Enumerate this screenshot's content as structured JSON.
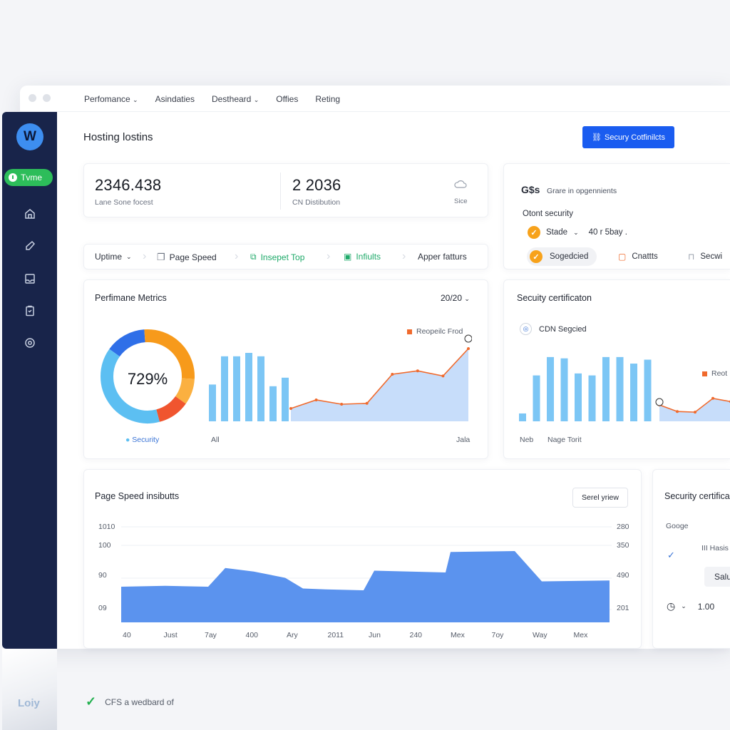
{
  "topnav": {
    "items": [
      {
        "label": "Perfomance",
        "has_chevron": true
      },
      {
        "label": "Asindaties",
        "has_chevron": false
      },
      {
        "label": "Destheard",
        "has_chevron": true
      },
      {
        "label": "Offies",
        "has_chevron": false
      },
      {
        "label": "Reting",
        "has_chevron": false
      }
    ]
  },
  "sidebar": {
    "logo_letter": "W",
    "pill_label": "Tvme",
    "icons": [
      "home-icon",
      "edit-icon",
      "inbox-icon",
      "clipboard-icon",
      "support-icon"
    ],
    "bottom_label": "Loiy"
  },
  "page": {
    "title": "Hosting lostins",
    "primary_button": "Secury Cotfinilcts"
  },
  "stats": {
    "stat1_value": "2346.438",
    "stat1_label": "Lane Sone focest",
    "stat2_value": "2 2036",
    "stat2_label": "CN Distibution",
    "stat3_label": "Sice"
  },
  "tabs": [
    {
      "label": "Uptime",
      "icon": "chevron-down-icon"
    },
    {
      "label": "Page Speed",
      "icon": "page-icon"
    },
    {
      "label": "Insepet Top",
      "icon": "inspect-icon"
    },
    {
      "label": "Infiults",
      "icon": "chart-icon"
    },
    {
      "label": "Apper fatturs",
      "icon": ""
    }
  ],
  "security_panel": {
    "badge": "G$s",
    "header": "Grare in opgennients",
    "subtitle": "Otont security",
    "row1_label": "Stade",
    "row1_value": "40 r 5bay .",
    "chip_label": "Sogedcied",
    "item2_label": "Cnattts",
    "item3_label": "Secwi"
  },
  "performance": {
    "title": "Perfimane Metrics",
    "period": "20/20",
    "donut_value": "729%",
    "donut_legend": "Security",
    "legend": "Reopeilc Frod",
    "x_start": "All",
    "x_end": "Jala"
  },
  "security_cert": {
    "title": "Secuity certificaton",
    "cdn_label": "CDN Segcied",
    "legend": "Reot",
    "x_start": "Neb",
    "x_label": "Nage Torit"
  },
  "page_speed": {
    "title": "Page Speed insibutts",
    "button": "Serel yriew",
    "y_left": [
      "1010",
      "100",
      "90",
      "09"
    ],
    "y_right": [
      "280",
      "350",
      "490",
      "201"
    ],
    "x_labels": [
      "40",
      "Just",
      "7ay",
      "400",
      "Ary",
      "2011",
      "Jun",
      "240",
      "Mex",
      "7oy",
      "Way",
      "Mex"
    ]
  },
  "security_cert2": {
    "title": "Security certifica",
    "google": "Googe",
    "item": "III Hasis",
    "button": "Salu",
    "value": "1.00"
  },
  "footer": {
    "note": "CFS a wedbard of"
  },
  "chart_data": [
    {
      "type": "pie",
      "title": "Perfimane Metrics",
      "center_label": "729%",
      "slices": [
        {
          "name": "blue",
          "value": 14,
          "color": "#2f6fe8"
        },
        {
          "name": "orange",
          "value": 27,
          "color": "#f79a1b"
        },
        {
          "name": "light-orange",
          "value": 9,
          "color": "#fbb040"
        },
        {
          "name": "red",
          "value": 11,
          "color": "#f0552f"
        },
        {
          "name": "light-blue",
          "value": 39,
          "color": "#5cbff2"
        }
      ]
    },
    {
      "type": "bar",
      "title": "Perfimane Metrics",
      "values": [
        43,
        76,
        76,
        80,
        76,
        41,
        51
      ],
      "ylim": [
        0,
        100
      ],
      "color": "#7cc6f5"
    },
    {
      "type": "area",
      "title": "Perfimane Metrics",
      "series": [
        {
          "name": "Reopeilc Frod",
          "values": [
            15,
            25,
            20,
            21,
            55,
            59,
            53,
            85
          ],
          "color": "#f06a2d"
        }
      ],
      "ylim": [
        0,
        100
      ]
    },
    {
      "type": "bar",
      "title": "Secuity certificaton",
      "values": [
        12,
        70,
        98,
        96,
        73,
        70,
        98,
        98,
        88,
        94
      ],
      "ylim": [
        0,
        100
      ],
      "color": "#7cc6f5"
    },
    {
      "type": "area",
      "title": "Secuity certificaton",
      "series": [
        {
          "name": "Reot",
          "values": [
            25,
            15,
            14,
            35,
            30
          ],
          "color": "#f06a2d"
        }
      ],
      "ylim": [
        0,
        100
      ]
    },
    {
      "type": "area",
      "title": "Page Speed insibutts",
      "x": [
        "40",
        "Just",
        "7ay",
        "400",
        "Ary",
        "2011",
        "Jun",
        "240",
        "Mex",
        "7oy",
        "Way",
        "Mex"
      ],
      "series": [
        {
          "name": "",
          "values": [
            40,
            41,
            40,
            61,
            57,
            50,
            38,
            37,
            36,
            58,
            57,
            56,
            79,
            80,
            46,
            47
          ],
          "color": "#5b93ee"
        }
      ],
      "ylim": [
        0,
        100
      ]
    }
  ]
}
